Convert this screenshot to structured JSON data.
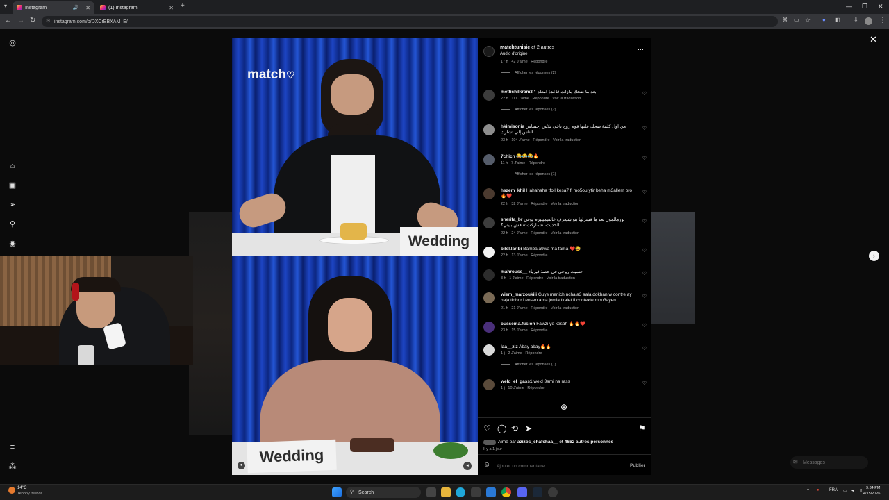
{
  "browser": {
    "tabs": [
      {
        "label": "Instagram",
        "active": true
      },
      {
        "label": "(1) Instagram",
        "active": false
      }
    ],
    "url": "instagram.com/p/DXCrEBXAM_E/"
  },
  "post": {
    "author": "matchtunisie",
    "author_suffix": "et 2 autres",
    "audio": "Audio d'origine",
    "brand_logo": "match",
    "card_top": "Wedding",
    "card_bottom": "Wedding"
  },
  "comments": [
    {
      "user": "",
      "text": "",
      "time": "17 h",
      "likes": "42 J'aime",
      "reply": "Répondre",
      "translate": "",
      "replies": "Afficher les réponses (2)"
    },
    {
      "user": "mettichilkram3",
      "text": "بعد ما ضحك مازلت قاعدة امعاه ؟",
      "time": "22 h",
      "likes": "111 J'aime",
      "reply": "Répondre",
      "translate": "Voir la traduction",
      "replies": "Afficher les réponses (2)"
    },
    {
      "user": "hkimisonia",
      "text": "من اول كلمة ضحك عليها قوم روح ياخي بلاش إحساس الناس إلي تشارك",
      "time": "23 h",
      "likes": "104 J'aime",
      "reply": "Répondre",
      "translate": "Voir la traduction",
      "replies": ""
    },
    {
      "user": "7chich",
      "text": "😂😂😂🔥",
      "time": "11 h",
      "likes": "7 J'aime",
      "reply": "Répondre",
      "translate": "",
      "replies": "Afficher les réponses (1)"
    },
    {
      "user": "hazem_khil",
      "text": "Hahahaha tfoll kesa7 fi mo5ou ytir beha m3allem bro 🔥❤️",
      "time": "22 h",
      "likes": "32 J'aime",
      "reply": "Répondre",
      "translate": "Voir la traduction",
      "replies": ""
    },
    {
      "user": "sherifa_br",
      "text": "نورمالمون بعد ما فسرلها هو شيعرف عالفيمينيزم يوفى الحديث، شماركت تناقش بنيتي؟",
      "time": "22 h",
      "likes": "24 J'aime",
      "reply": "Répondre",
      "translate": "Voir la traduction",
      "replies": ""
    },
    {
      "user": "bilel.laribi",
      "text": "Bamba a9wa ma fama ❤️😂",
      "time": "22 h",
      "likes": "13 J'aime",
      "reply": "Répondre",
      "translate": "",
      "replies": ""
    },
    {
      "user": "mahrouse__",
      "text": "حسيت روحي في حصة فيزياء",
      "time": "3 h",
      "likes": "1 J'aime",
      "reply": "Répondre",
      "translate": "Voir la traduction",
      "replies": ""
    },
    {
      "user": "wiem_marzoukiii",
      "text": "Guys menich nchaja3 aala dokhan w contre ay haja tidhor l ensen ama jomla tkalet fi contexte mou3ayen",
      "time": "21 h",
      "likes": "21 J'aime",
      "reply": "Répondre",
      "translate": "Voir la traduction",
      "replies": ""
    },
    {
      "user": "oussema.fusion",
      "text": "Fawzi ye kesah 🔥🔥❤️",
      "time": "23 h",
      "likes": "15 J'aime",
      "reply": "Répondre",
      "translate": "",
      "replies": ""
    },
    {
      "user": "laa__ziz",
      "text": "Abay abay🔥🔥",
      "time": "1 j",
      "likes": "2 J'aime",
      "reply": "Répondre",
      "translate": "",
      "replies": "Afficher les réponses (1)"
    },
    {
      "user": "weld_el_gass1",
      "text": "weld 3ami na rass",
      "time": "1 j",
      "likes": "10 J'aime",
      "reply": "Répondre",
      "translate": "",
      "replies": ""
    }
  ],
  "liked_by": {
    "prefix": "Aimé par",
    "user": "azizos_chafchaa__",
    "rest": "et 4662 autres personnes"
  },
  "post_time": "Il y a 1 jour",
  "comment_box": {
    "placeholder": "Ajouter un commentaire...",
    "publish": "Publier"
  },
  "messages_label": "Messages",
  "taskbar": {
    "weather_temp": "14°C",
    "weather_desc": "Tebbny. fellhös",
    "search": "Search",
    "lang": "FRA",
    "time": "9:34 PM",
    "date": "4/15/2026"
  }
}
